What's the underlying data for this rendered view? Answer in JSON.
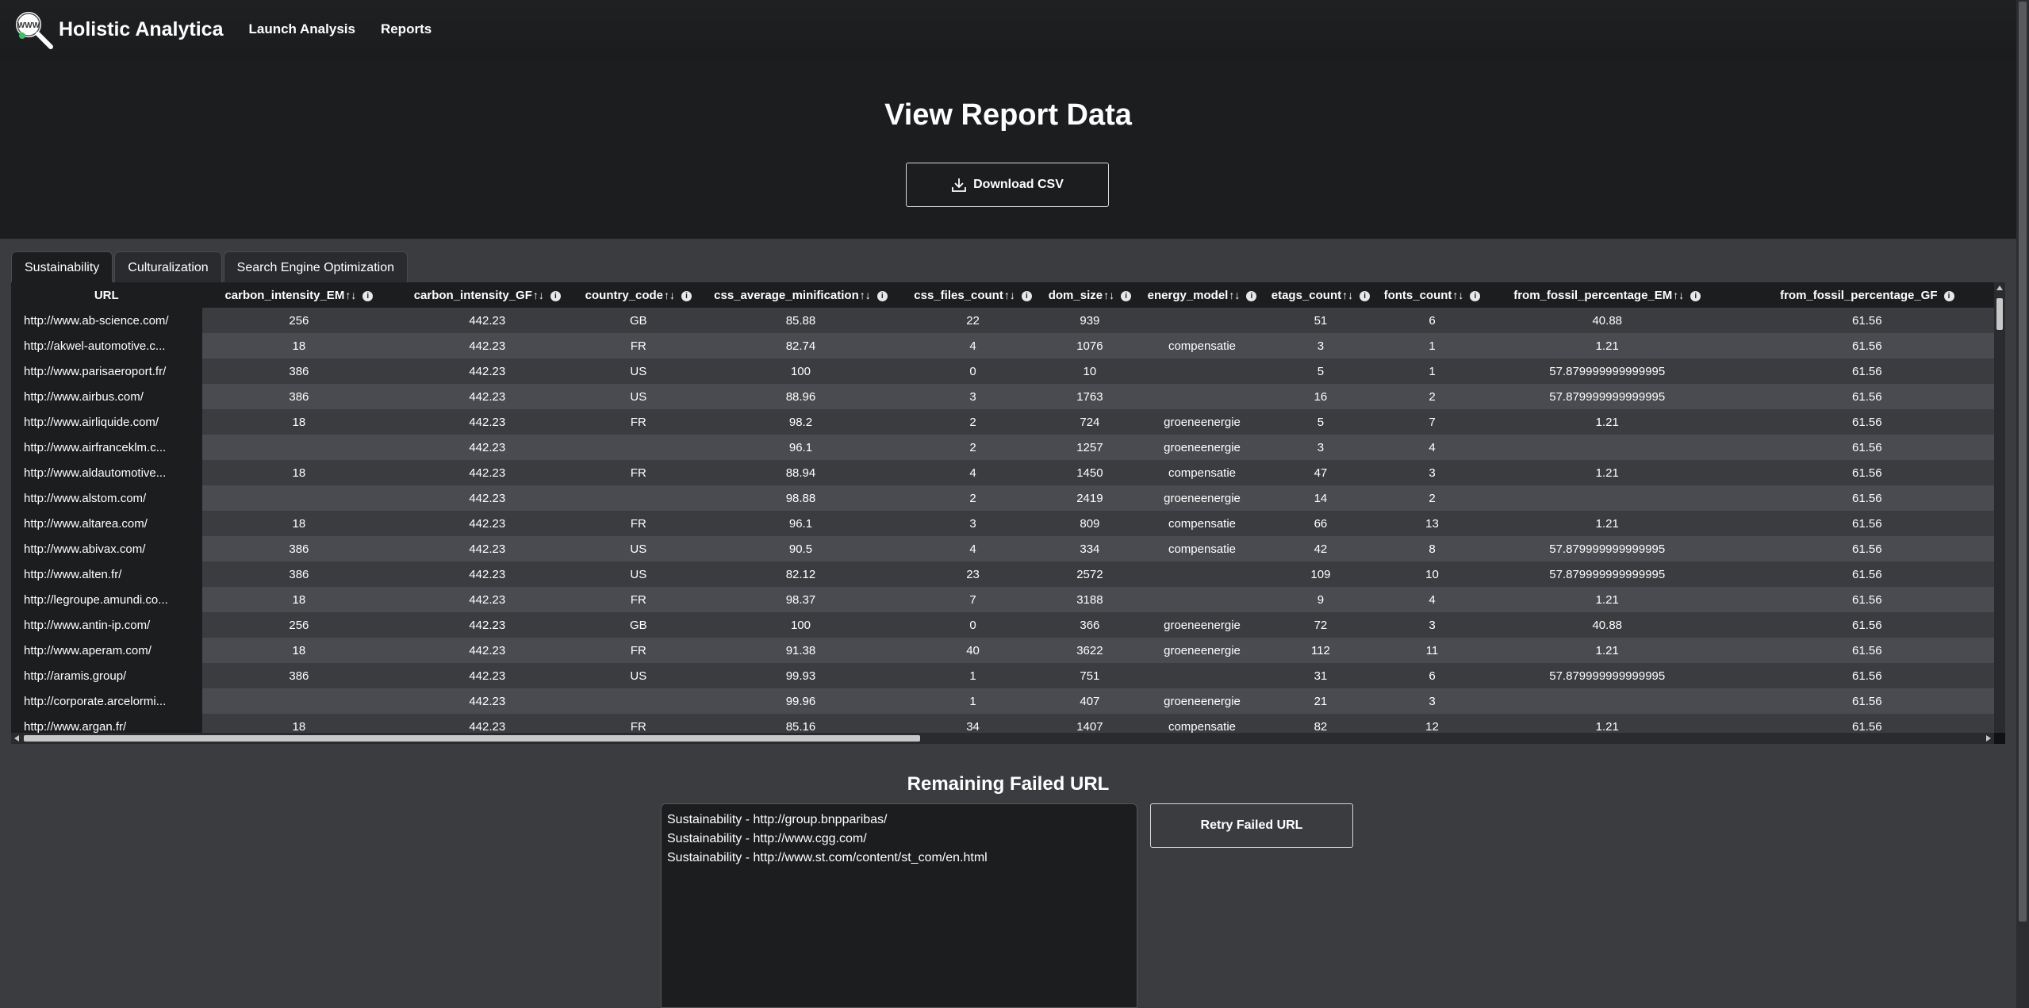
{
  "navbar": {
    "brand": "Holistic Analytica",
    "links": [
      "Launch Analysis",
      "Reports"
    ]
  },
  "hero": {
    "title": "View Report Data",
    "download_label": "Download CSV"
  },
  "tabs": [
    "Sustainability",
    "Culturalization",
    "Search Engine Optimization"
  ],
  "active_tab": "Sustainability",
  "table": {
    "columns": [
      "URL",
      "carbon_intensity_EM",
      "carbon_intensity_GF",
      "country_code",
      "css_average_minification",
      "css_files_count",
      "dom_size",
      "energy_model",
      "etags_count",
      "fonts_count",
      "from_fossil_percentage_EM",
      "from_fossil_percentage_GF"
    ],
    "sortable": [
      false,
      true,
      true,
      true,
      true,
      true,
      true,
      true,
      true,
      true,
      true,
      false
    ],
    "rows": [
      [
        "http://www.ab-science.com/",
        "256",
        "442.23",
        "GB",
        "85.88",
        "22",
        "939",
        "",
        "51",
        "6",
        "40.88",
        "61.56"
      ],
      [
        "http://akwel-automotive.c...",
        "18",
        "442.23",
        "FR",
        "82.74",
        "4",
        "1076",
        "compensatie",
        "3",
        "1",
        "1.21",
        "61.56"
      ],
      [
        "http://www.parisaeroport.fr/",
        "386",
        "442.23",
        "US",
        "100",
        "0",
        "10",
        "",
        "5",
        "1",
        "57.879999999999995",
        "61.56"
      ],
      [
        "http://www.airbus.com/",
        "386",
        "442.23",
        "US",
        "88.96",
        "3",
        "1763",
        "",
        "16",
        "2",
        "57.879999999999995",
        "61.56"
      ],
      [
        "http://www.airliquide.com/",
        "18",
        "442.23",
        "FR",
        "98.2",
        "2",
        "724",
        "groeneenergie",
        "5",
        "7",
        "1.21",
        "61.56"
      ],
      [
        "http://www.airfranceklm.c...",
        "",
        "442.23",
        "",
        "96.1",
        "2",
        "1257",
        "groeneenergie",
        "3",
        "4",
        "",
        "61.56"
      ],
      [
        "http://www.aldautomotive...",
        "18",
        "442.23",
        "FR",
        "88.94",
        "4",
        "1450",
        "compensatie",
        "47",
        "3",
        "1.21",
        "61.56"
      ],
      [
        "http://www.alstom.com/",
        "",
        "442.23",
        "",
        "98.88",
        "2",
        "2419",
        "groeneenergie",
        "14",
        "2",
        "",
        "61.56"
      ],
      [
        "http://www.altarea.com/",
        "18",
        "442.23",
        "FR",
        "96.1",
        "3",
        "809",
        "compensatie",
        "66",
        "13",
        "1.21",
        "61.56"
      ],
      [
        "http://www.abivax.com/",
        "386",
        "442.23",
        "US",
        "90.5",
        "4",
        "334",
        "compensatie",
        "42",
        "8",
        "57.879999999999995",
        "61.56"
      ],
      [
        "http://www.alten.fr/",
        "386",
        "442.23",
        "US",
        "82.12",
        "23",
        "2572",
        "",
        "109",
        "10",
        "57.879999999999995",
        "61.56"
      ],
      [
        "http://legroupe.amundi.co...",
        "18",
        "442.23",
        "FR",
        "98.37",
        "7",
        "3188",
        "",
        "9",
        "4",
        "1.21",
        "61.56"
      ],
      [
        "http://www.antin-ip.com/",
        "256",
        "442.23",
        "GB",
        "100",
        "0",
        "366",
        "groeneenergie",
        "72",
        "3",
        "40.88",
        "61.56"
      ],
      [
        "http://www.aperam.com/",
        "18",
        "442.23",
        "FR",
        "91.38",
        "40",
        "3622",
        "groeneenergie",
        "112",
        "11",
        "1.21",
        "61.56"
      ],
      [
        "http://aramis.group/",
        "386",
        "442.23",
        "US",
        "99.93",
        "1",
        "751",
        "",
        "31",
        "6",
        "57.879999999999995",
        "61.56"
      ],
      [
        "http://corporate.arcelormi...",
        "",
        "442.23",
        "",
        "99.96",
        "1",
        "407",
        "groeneenergie",
        "21",
        "3",
        "",
        "61.56"
      ],
      [
        "http://www.argan.fr/",
        "18",
        "442.23",
        "FR",
        "85.16",
        "34",
        "1407",
        "compensatie",
        "82",
        "12",
        "1.21",
        "61.56"
      ]
    ]
  },
  "failed": {
    "title": "Remaining Failed URL",
    "lines": [
      "Sustainability - http://group.bnpparibas/",
      "Sustainability - http://www.cgg.com/",
      "Sustainability - http://www.st.com/content/st_com/en.html"
    ],
    "retry_label": "Retry Failed URL"
  },
  "icons": {
    "logo": "magnifier-www-logo-icon",
    "download": "download-icon",
    "sort": "sort-arrows-icon",
    "info": "info-icon"
  },
  "colors": {
    "nav_bg": "#1f2022",
    "hero_bg": "#1c1d1f",
    "page_bg": "#3b3c40",
    "row_alt": "#4a4b50"
  }
}
